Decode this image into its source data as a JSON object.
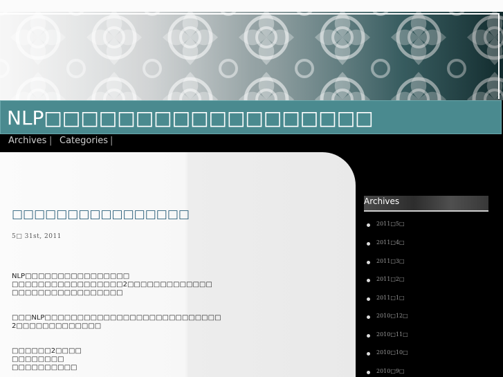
{
  "site": {
    "title": "NLP□□□□□□□□□□□□□□□□□□"
  },
  "nav": {
    "items": [
      {
        "label": "Archives"
      },
      {
        "label": "Categories"
      }
    ],
    "separator": "|"
  },
  "post": {
    "title": "□□□□□□□□□□□□□□□□",
    "date": "5□ 31st, 2011",
    "paragraphs": [
      [
        "NLP□□□□□□□□□□□□□□□□",
        "□□□□□□□□□□□□□□□□□2□□□□□□□□□□□□□",
        "□□□□□□□□□□□□□□□□□"
      ],
      [
        "□□□NLP□□□□□□□□□□□□□□□□□□□□□□□□□□□",
        "2□□□□□□□□□□□□□"
      ],
      [
        "□□□□□□2□□□□",
        "□□□□□□□□",
        "□□□□□□□□□□"
      ]
    ]
  },
  "sidebar": {
    "archives": {
      "title": "Archives",
      "items": [
        {
          "label": "2011□5□"
        },
        {
          "label": "2011□4□"
        },
        {
          "label": "2011□3□"
        },
        {
          "label": "2011□2□"
        },
        {
          "label": "2011□1□"
        },
        {
          "label": "2010□12□"
        },
        {
          "label": "2010□11□"
        },
        {
          "label": "2010□10□"
        },
        {
          "label": "2010□9□"
        }
      ]
    }
  },
  "colors": {
    "title_bar": "#4a8a8f",
    "post_title": "#2a5f7a",
    "sidebar_bg": "#000000"
  }
}
